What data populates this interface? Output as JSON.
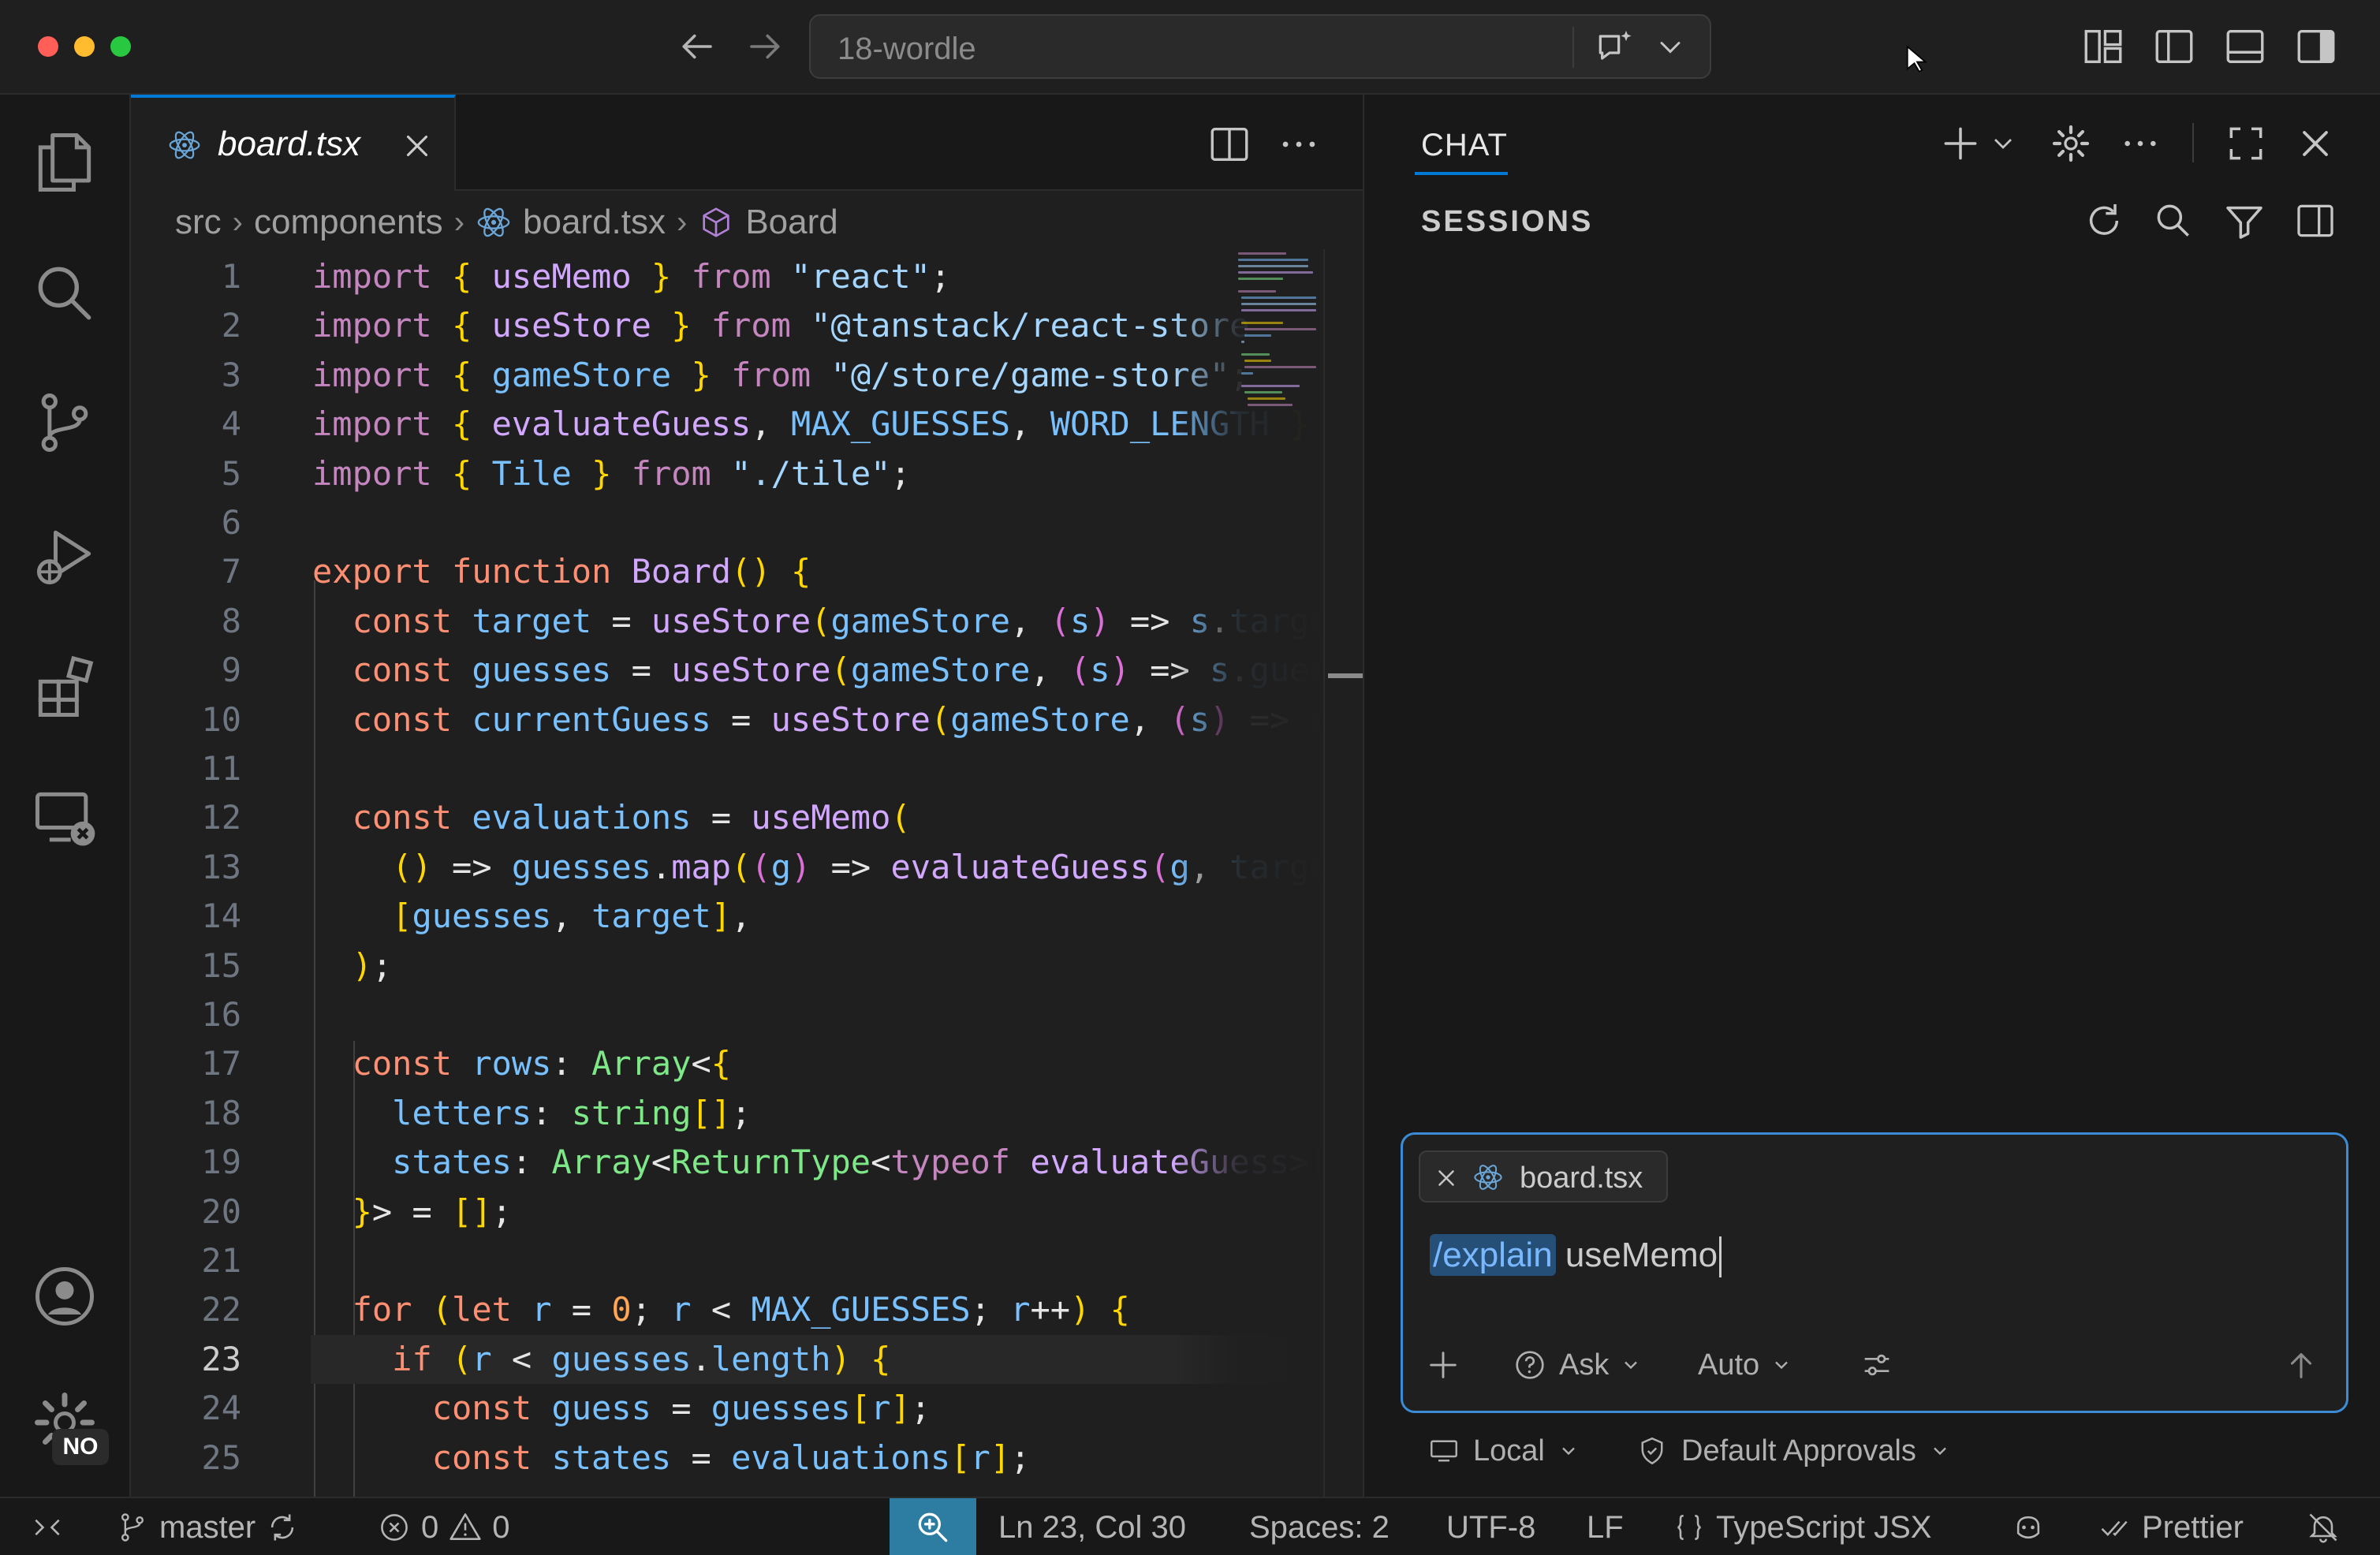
{
  "window": {
    "command_center_text": "18-wordle"
  },
  "editor": {
    "tab": {
      "label": "board.tsx"
    },
    "breadcrumb": [
      "src",
      "components",
      "board.tsx",
      "Board"
    ],
    "cursor_line": 23,
    "lines": [
      {
        "n": "1"
      },
      {
        "n": "2"
      },
      {
        "n": "3"
      },
      {
        "n": "4"
      },
      {
        "n": "5"
      },
      {
        "n": "6"
      },
      {
        "n": "7"
      },
      {
        "n": "8"
      },
      {
        "n": "9"
      },
      {
        "n": "10"
      },
      {
        "n": "11"
      },
      {
        "n": "12"
      },
      {
        "n": "13"
      },
      {
        "n": "14"
      },
      {
        "n": "15"
      },
      {
        "n": "16"
      },
      {
        "n": "17"
      },
      {
        "n": "18"
      },
      {
        "n": "19"
      },
      {
        "n": "20"
      },
      {
        "n": "21"
      },
      {
        "n": "22"
      },
      {
        "n": "23"
      },
      {
        "n": "24"
      },
      {
        "n": "25"
      }
    ],
    "code": [
      "import { useMemo } from \"react\";",
      "import { useStore } from \"@tanstack/react-store",
      "import { gameStore } from \"@/store/game-store\";",
      "import { evaluateGuess, MAX_GUESSES, WORD_LENGTH }",
      "import { Tile } from \"./tile\";",
      "",
      "export function Board() {",
      "  const target = useStore(gameStore, (s) => s.target",
      "  const guesses = useStore(gameStore, (s) => s.guess",
      "  const currentGuess = useStore(gameStore, (s) => s.",
      "",
      "  const evaluations = useMemo(",
      "    () => guesses.map((g) => evaluateGuess(g, target",
      "    [guesses, target],",
      "  );",
      "",
      "  const rows: Array<{",
      "    letters: string[];",
      "    states: Array<ReturnType<typeof evaluateGuess>[n",
      "  }> = [];",
      "",
      "  for (let r = 0; r < MAX_GUESSES; r++) {",
      "    if (r < guesses.length) {",
      "      const guess = guesses[r];",
      "      const states = evaluations[r];"
    ]
  },
  "chat": {
    "title": "CHAT",
    "sessions_label": "SESSIONS",
    "context_chip": "board.tsx",
    "prompt_command": "/explain",
    "prompt_text": " useMemo",
    "mode_label": "Ask",
    "model_label": "Auto",
    "location_label": "Local",
    "approvals_label": "Default Approvals"
  },
  "status": {
    "branch": "master",
    "errors": "0",
    "warnings": "0",
    "position": "Ln 23, Col 30",
    "spaces": "Spaces: 2",
    "encoding": "UTF-8",
    "eol": "LF",
    "language": "TypeScript JSX",
    "formatter": "Prettier",
    "settings_badge": "NO"
  },
  "colors": {
    "accent": "#0078d4",
    "zoom_bg": "#2d7da3",
    "editor_bg": "#1f1f1f"
  }
}
